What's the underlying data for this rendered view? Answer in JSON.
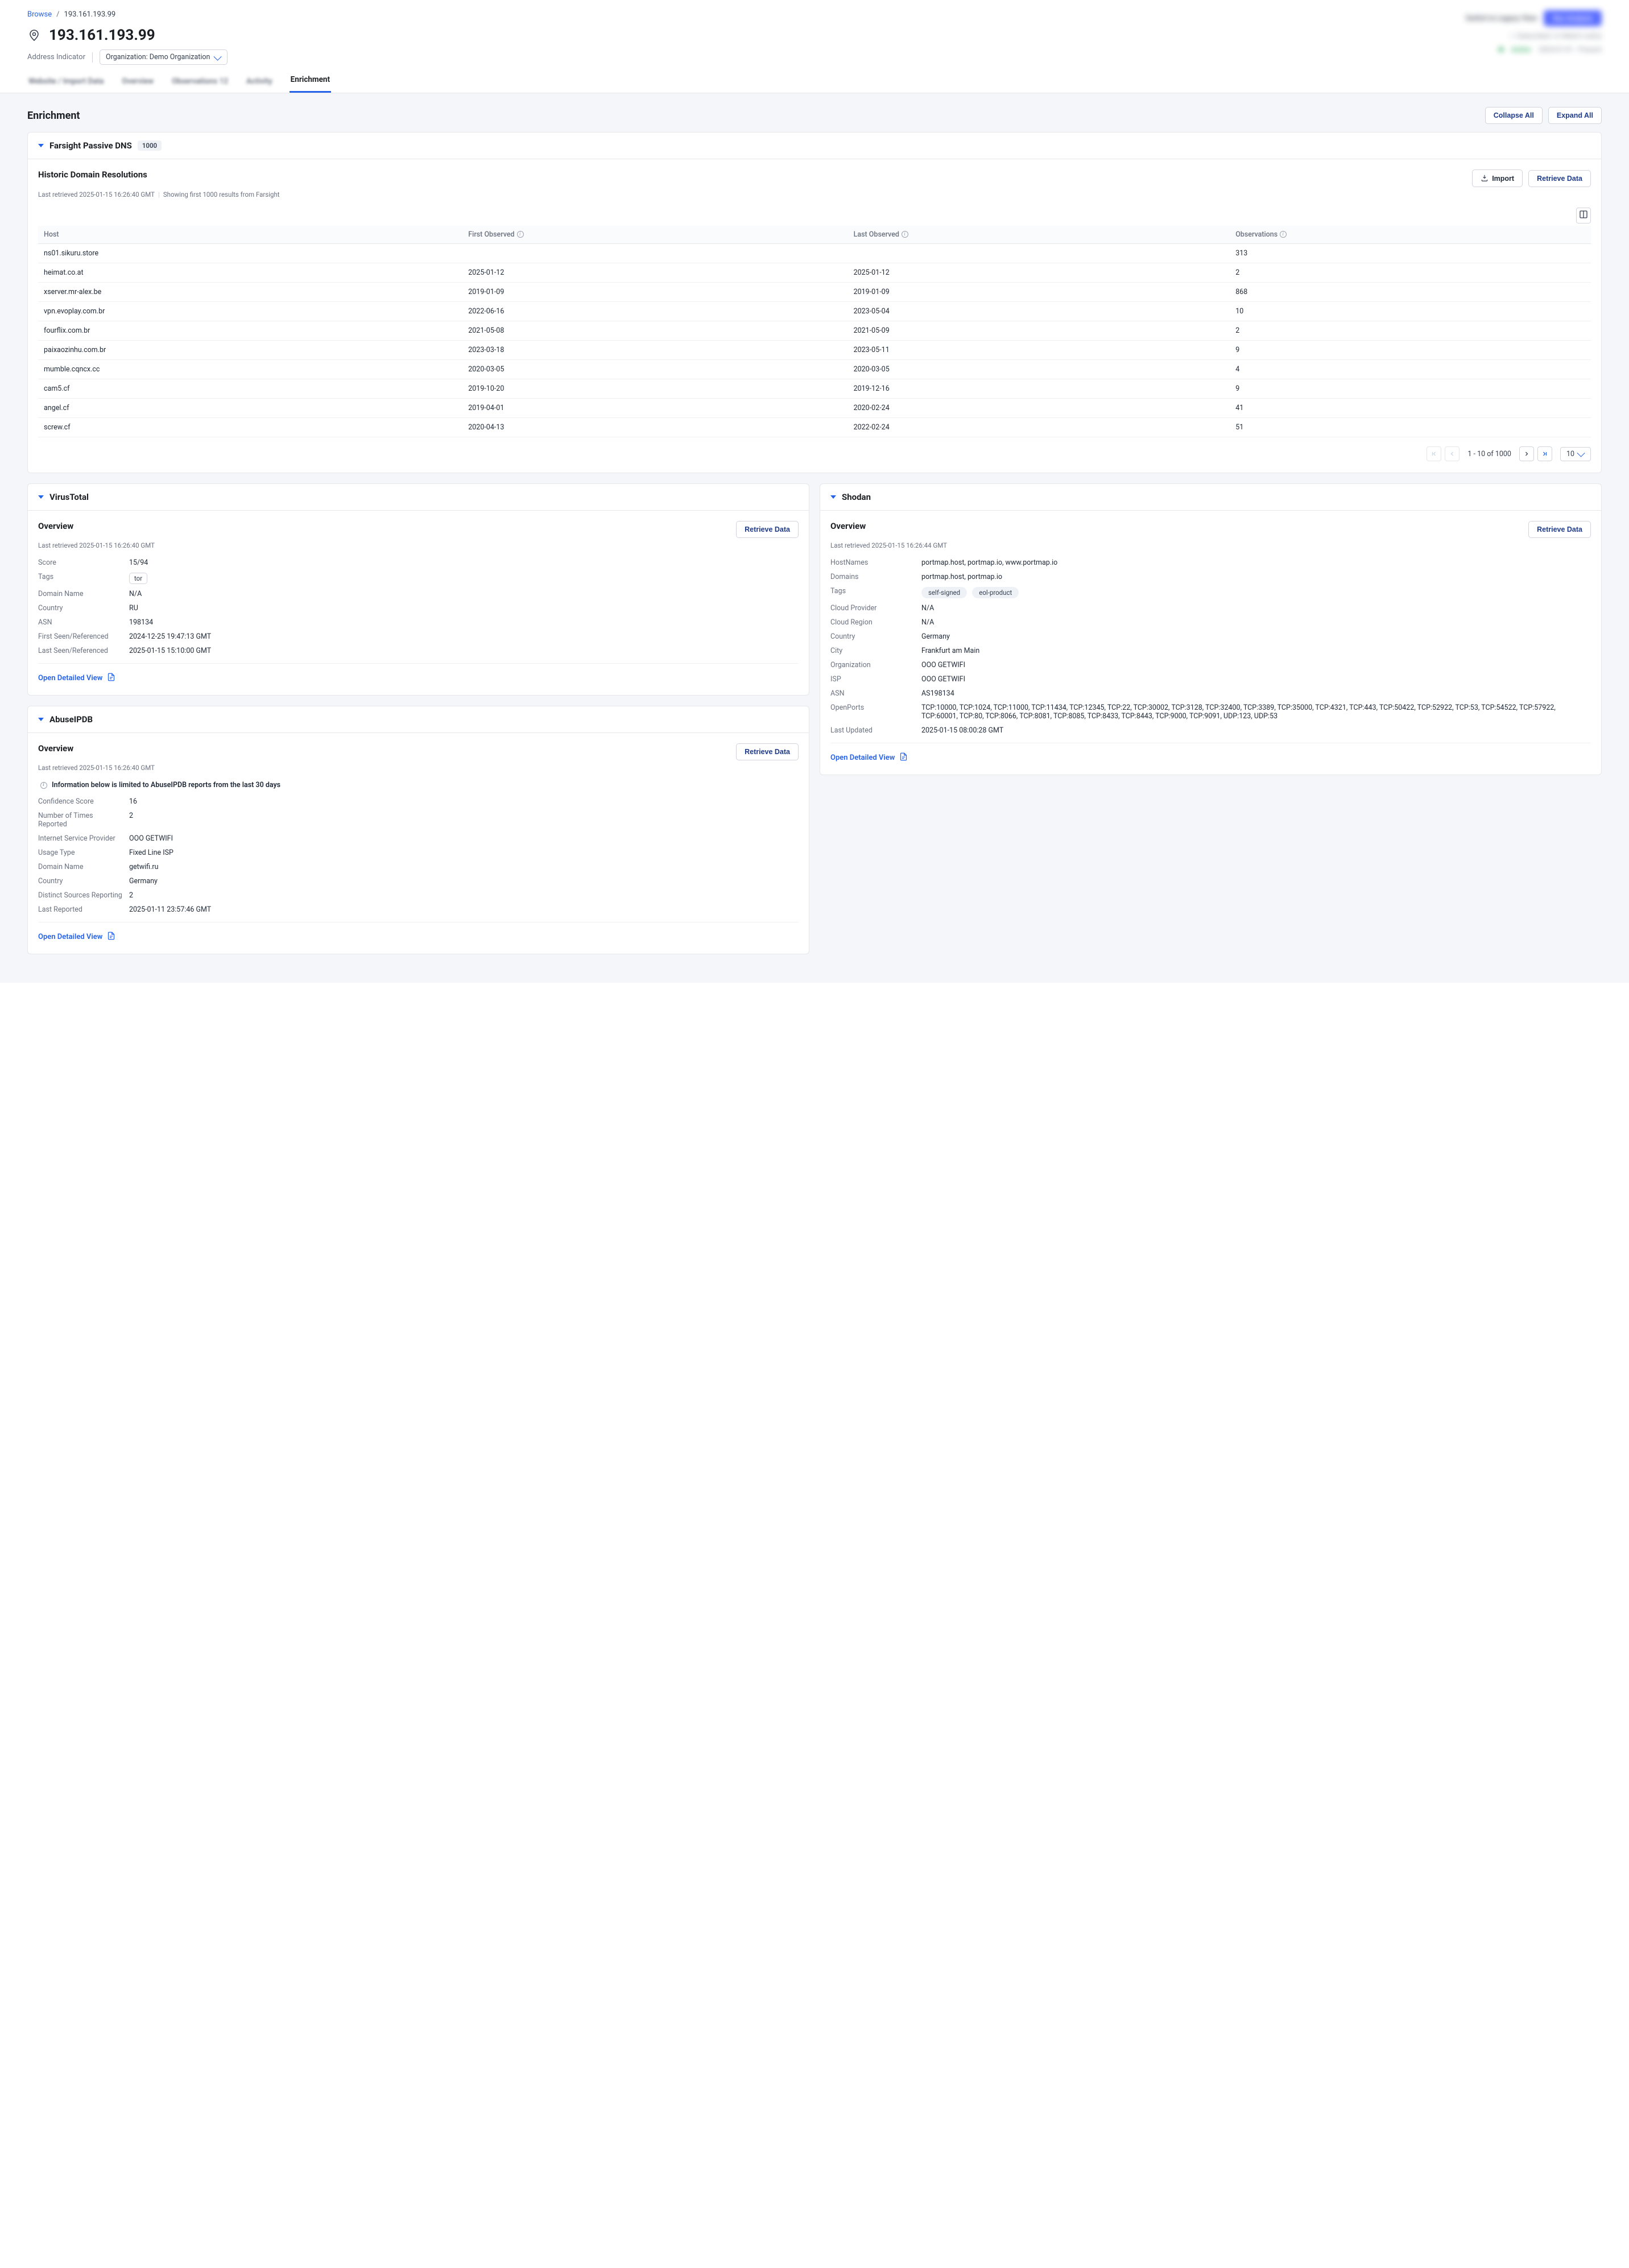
{
  "breadcrumb": {
    "root": "Browse",
    "current": "193.161.193.99"
  },
  "page": {
    "title": "193.161.193.99",
    "indicator_type": "Address Indicator",
    "org_label": "Organization: Demo Organization"
  },
  "header_blur": {
    "switch": "Switch to Legacy View",
    "action": "Run Analysis",
    "sub1": "Subscribed",
    "sub2": "In Watch List(s)",
    "status": "Active",
    "period": "2024-01-01 - Present"
  },
  "tabs": {
    "t0": "Website / Import Data",
    "t1": "Overview",
    "t2": "Observations  12",
    "t3": "Activity",
    "t4": "Enrichment"
  },
  "section_title": "Enrichment",
  "buttons": {
    "collapse_all": "Collapse All",
    "expand_all": "Expand All",
    "import": "Import",
    "retrieve": "Retrieve Data",
    "open_detail": "Open Detailed View"
  },
  "farsight": {
    "title": "Farsight Passive DNS",
    "count": "1000",
    "subtitle": "Historic Domain Resolutions",
    "meta_a": "Last retrieved 2025-01-15 16:26:40 GMT",
    "meta_b": "Showing first 1000 results from Farsight",
    "cols": {
      "host": "Host",
      "first": "First Observed",
      "last": "Last Observed",
      "obs": "Observations"
    },
    "rows": [
      {
        "host": "ns01.sikuru.store",
        "first": "",
        "last": "",
        "obs": "313"
      },
      {
        "host": "heimat.co.at",
        "first": "2025-01-12",
        "last": "2025-01-12",
        "obs": "2"
      },
      {
        "host": "xserver.mr-alex.be",
        "first": "2019-01-09",
        "last": "2019-01-09",
        "obs": "868"
      },
      {
        "host": "vpn.evoplay.com.br",
        "first": "2022-06-16",
        "last": "2023-05-04",
        "obs": "10"
      },
      {
        "host": "fourflix.com.br",
        "first": "2021-05-08",
        "last": "2021-05-09",
        "obs": "2"
      },
      {
        "host": "paixaozinhu.com.br",
        "first": "2023-03-18",
        "last": "2023-05-11",
        "obs": "9"
      },
      {
        "host": "mumble.cqncx.cc",
        "first": "2020-03-05",
        "last": "2020-03-05",
        "obs": "4"
      },
      {
        "host": "cam5.cf",
        "first": "2019-10-20",
        "last": "2019-12-16",
        "obs": "9"
      },
      {
        "host": "angel.cf",
        "first": "2019-04-01",
        "last": "2020-02-24",
        "obs": "41"
      },
      {
        "host": "screw.cf",
        "first": "2020-04-13",
        "last": "2022-02-24",
        "obs": "51"
      }
    ],
    "pager": {
      "range": "1 - 10 of 1000",
      "size": "10"
    }
  },
  "virustotal": {
    "title": "VirusTotal",
    "subtitle": "Overview",
    "meta": "Last retrieved 2025-01-15 16:26:40 GMT",
    "kv": {
      "score_k": "Score",
      "score_v": "15/94",
      "tags_k": "Tags",
      "tags_v": "tor",
      "dn_k": "Domain Name",
      "dn_v": "N/A",
      "country_k": "Country",
      "country_v": "RU",
      "asn_k": "ASN",
      "asn_v": "198134",
      "first_k": "First Seen/Referenced",
      "first_v": "2024-12-25 19:47:13 GMT",
      "last_k": "Last Seen/Referenced",
      "last_v": "2025-01-15 15:10:00 GMT"
    }
  },
  "abuseipdb": {
    "title": "AbuseIPDB",
    "subtitle": "Overview",
    "meta": "Last retrieved 2025-01-15 16:26:40 GMT",
    "notice": "Information below is limited to AbuseIPDB reports from the last 30 days",
    "kv": {
      "conf_k": "Confidence Score",
      "conf_v": "16",
      "num_k": "Number of Times Reported",
      "num_v": "2",
      "isp_k": "Internet Service Provider",
      "isp_v": "OOO GETWIFI",
      "usage_k": "Usage Type",
      "usage_v": "Fixed Line ISP",
      "dn_k": "Domain Name",
      "dn_v": "getwifi.ru",
      "country_k": "Country",
      "country_v": "Germany",
      "src_k": "Distinct Sources Reporting",
      "src_v": "2",
      "last_k": "Last Reported",
      "last_v": "2025-01-11 23:57:46 GMT"
    }
  },
  "shodan": {
    "title": "Shodan",
    "subtitle": "Overview",
    "meta": "Last retrieved 2025-01-15 16:26:44 GMT",
    "kv": {
      "hn_k": "HostNames",
      "hn_v": "portmap.host, portmap.io, www.portmap.io",
      "dom_k": "Domains",
      "dom_v": "portmap.host, portmap.io",
      "tags_k": "Tags",
      "tags_v1": "self-signed",
      "tags_v2": "eol-product",
      "cp_k": "Cloud Provider",
      "cp_v": "N/A",
      "cr_k": "Cloud Region",
      "cr_v": "N/A",
      "country_k": "Country",
      "country_v": "Germany",
      "city_k": "City",
      "city_v": "Frankfurt am Main",
      "org_k": "Organization",
      "org_v": "OOO GETWIFI",
      "isp_k": "ISP",
      "isp_v": "OOO GETWIFI",
      "asn_k": "ASN",
      "asn_v": "AS198134",
      "ports_k": "OpenPorts",
      "ports_v": "TCP:10000, TCP:1024, TCP:11000, TCP:11434, TCP:12345, TCP:22, TCP:30002, TCP:3128, TCP:32400, TCP:3389, TCP:35000, TCP:4321, TCP:443, TCP:50422, TCP:52922, TCP:53, TCP:54522, TCP:57922, TCP:60001, TCP:80, TCP:8066, TCP:8081, TCP:8085, TCP:8433, TCP:8443, TCP:9000, TCP:9091, UDP:123, UDP:53",
      "lu_k": "Last Updated",
      "lu_v": "2025-01-15 08:00:28 GMT"
    }
  }
}
